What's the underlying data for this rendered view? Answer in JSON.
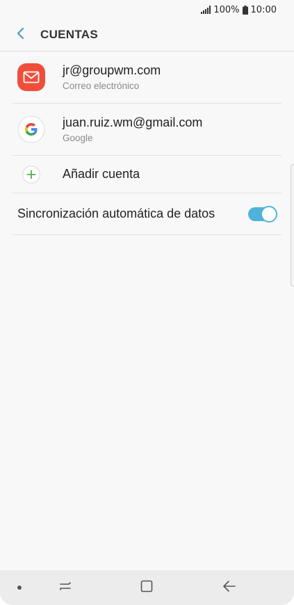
{
  "status_bar": {
    "battery_percent": "100%",
    "time": "10:00"
  },
  "header": {
    "title": "CUENTAS"
  },
  "accounts": [
    {
      "email": "jr@groupwm.com",
      "type": "Correo electrónico",
      "icon": "email-icon"
    },
    {
      "email": "juan.ruiz.wm@gmail.com",
      "type": "Google",
      "icon": "google-icon"
    }
  ],
  "add_account": {
    "label": "Añadir cuenta"
  },
  "sync": {
    "label": "Sincronización automática de datos",
    "enabled": true
  },
  "colors": {
    "accent": "#4fb3d9",
    "email_icon_bg": "#f04e3b",
    "add_icon": "#4caf50"
  },
  "nav": {
    "icons": [
      "recents-icon",
      "home-icon",
      "back-icon"
    ]
  }
}
